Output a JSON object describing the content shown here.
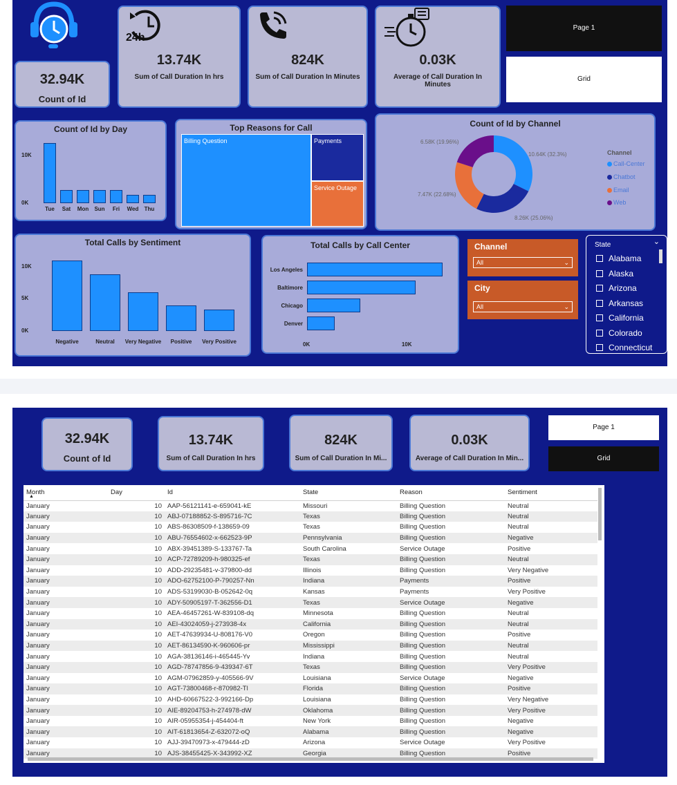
{
  "top": {
    "kpis": [
      {
        "value": "32.94K",
        "label": "Count of Id"
      },
      {
        "value": "13.74K",
        "label": "Sum of Call Duration In hrs"
      },
      {
        "value": "824K",
        "label": "Sum of Call Duration In Minutes"
      },
      {
        "value": "0.03K",
        "label": "Average of Call Duration In Minutes"
      }
    ],
    "nav": {
      "page1": "Page 1",
      "grid": "Grid"
    },
    "icons": {
      "kpi1": "headset-clock-icon",
      "kpi2": "24h-history-icon",
      "kpi3": "phone-ringing-icon",
      "kpi4": "stopwatch-speed-icon"
    },
    "icon_24h": "24h"
  },
  "chart_data": [
    {
      "type": "bar",
      "title": "Count of Id by Day",
      "categories": [
        "Tue",
        "Sat",
        "Mon",
        "Sun",
        "Fri",
        "Wed",
        "Thu"
      ],
      "values": [
        12500,
        2800,
        2800,
        2800,
        2700,
        1700,
        1700
      ],
      "yticks": [
        "10K",
        "0K"
      ],
      "ylim": [
        0,
        13000
      ]
    },
    {
      "type": "treemap",
      "title": "Top Reasons for Call",
      "categories": [
        "Billing Question",
        "Payments",
        "Service Outage"
      ],
      "colors": [
        "#1e90ff",
        "#1a2a9e",
        "#e8703a"
      ]
    },
    {
      "type": "pie",
      "title": "Count of Id by Channel",
      "legend_title": "Channel",
      "categories": [
        "Call-Center",
        "Chatbot",
        "Email",
        "Web"
      ],
      "values": [
        10.64,
        8.26,
        7.47,
        6.58
      ],
      "labels": [
        "10.64K (32.3%)",
        "8.26K (25.06%)",
        "7.47K (22.68%)",
        "6.58K (19.96%)"
      ],
      "colors": [
        "#1e90ff",
        "#1a2a9e",
        "#e8703a",
        "#6a0f8a"
      ]
    },
    {
      "type": "bar",
      "title": "Total Calls by Sentiment",
      "categories": [
        "Negative",
        "Neutral",
        "Very Negative",
        "Positive",
        "Very Positive"
      ],
      "values": [
        11000,
        8800,
        6000,
        4000,
        3300
      ],
      "yticks": [
        "10K",
        "5K",
        "0K"
      ],
      "ylim": [
        0,
        11500
      ]
    },
    {
      "type": "bar",
      "orientation": "horizontal",
      "title": "Total Calls by Call Center",
      "categories": [
        "Los Angeles",
        "Baltimore",
        "Chicago",
        "Denver"
      ],
      "values": [
        13700,
        11000,
        5400,
        2800
      ],
      "xticks": [
        "0K",
        "10K"
      ],
      "xlim": [
        0,
        14000
      ]
    }
  ],
  "slicers": {
    "channel": {
      "title": "Channel",
      "value": "All"
    },
    "city": {
      "title": "City",
      "value": "All"
    },
    "state": {
      "title": "State",
      "items": [
        "Alabama",
        "Alaska",
        "Arizona",
        "Arkansas",
        "California",
        "Colorado",
        "Connecticut"
      ]
    }
  },
  "grid_page": {
    "kpis": [
      {
        "value": "32.94K",
        "label": "Count of Id"
      },
      {
        "value": "13.74K",
        "label": "Sum of Call Duration In hrs"
      },
      {
        "value": "824K",
        "label": "Sum of Call Duration In Mi..."
      },
      {
        "value": "0.03K",
        "label": "Average of Call Duration In Min..."
      }
    ],
    "nav": {
      "page1": "Page 1",
      "grid": "Grid"
    },
    "table": {
      "columns": [
        "Month",
        "Day",
        "Id",
        "State",
        "Reason",
        "Sentiment"
      ],
      "rows": [
        [
          "January",
          "10",
          "AAP-56121141-e-659041-kE",
          "Missouri",
          "Billing Question",
          "Neutral"
        ],
        [
          "January",
          "10",
          "ABJ-07188852-S-895716-7C",
          "Texas",
          "Billing Question",
          "Neutral"
        ],
        [
          "January",
          "10",
          "ABS-86308509-f-138659-09",
          "Texas",
          "Billing Question",
          "Neutral"
        ],
        [
          "January",
          "10",
          "ABU-76554602-x-662523-9P",
          "Pennsylvania",
          "Billing Question",
          "Negative"
        ],
        [
          "January",
          "10",
          "ABX-39451389-S-133767-Ta",
          "South Carolina",
          "Service Outage",
          "Positive"
        ],
        [
          "January",
          "10",
          "ACP-72789209-h-980325-ef",
          "Texas",
          "Billing Question",
          "Neutral"
        ],
        [
          "January",
          "10",
          "ADD-29235481-v-379800-dd",
          "Illinois",
          "Billing Question",
          "Very Negative"
        ],
        [
          "January",
          "10",
          "ADO-62752100-P-790257-Nn",
          "Indiana",
          "Payments",
          "Positive"
        ],
        [
          "January",
          "10",
          "ADS-53199030-B-052642-0q",
          "Kansas",
          "Payments",
          "Very Positive"
        ],
        [
          "January",
          "10",
          "ADY-50905197-T-362556-D1",
          "Texas",
          "Service Outage",
          "Negative"
        ],
        [
          "January",
          "10",
          "AEA-46457261-W-839108-dq",
          "Minnesota",
          "Billing Question",
          "Neutral"
        ],
        [
          "January",
          "10",
          "AEI-43024059-j-273938-4x",
          "California",
          "Billing Question",
          "Neutral"
        ],
        [
          "January",
          "10",
          "AET-47639934-U-808176-V0",
          "Oregon",
          "Billing Question",
          "Positive"
        ],
        [
          "January",
          "10",
          "AET-86134590-K-960606-pr",
          "Mississippi",
          "Billing Question",
          "Neutral"
        ],
        [
          "January",
          "10",
          "AGA-38136146-i-465445-Yv",
          "Indiana",
          "Billing Question",
          "Neutral"
        ],
        [
          "January",
          "10",
          "AGD-78747856-9-439347-6T",
          "Texas",
          "Billing Question",
          "Very Positive"
        ],
        [
          "January",
          "10",
          "AGM-07962859-y-405566-9V",
          "Louisiana",
          "Service Outage",
          "Negative"
        ],
        [
          "January",
          "10",
          "AGT-73800468-r-870982-Tl",
          "Florida",
          "Billing Question",
          "Positive"
        ],
        [
          "January",
          "10",
          "AHD-60667522-3-992166-Dp",
          "Louisiana",
          "Billing Question",
          "Very Negative"
        ],
        [
          "January",
          "10",
          "AIE-89204753-h-274978-dW",
          "Oklahoma",
          "Billing Question",
          "Very Positive"
        ],
        [
          "January",
          "10",
          "AIR-05955354-j-454404-ft",
          "New York",
          "Billing Question",
          "Negative"
        ],
        [
          "January",
          "10",
          "AIT-61813654-Z-632072-oQ",
          "Alabama",
          "Billing Question",
          "Negative"
        ],
        [
          "January",
          "10",
          "AJJ-39470973-x-479444-zD",
          "Arizona",
          "Service Outage",
          "Very Positive"
        ],
        [
          "January",
          "10",
          "AJS-38455425-X-343992-XZ",
          "Georgia",
          "Billing Question",
          "Positive"
        ]
      ]
    }
  },
  "colors": {
    "background": "#0f1a8a",
    "card": "#b9b9d4",
    "accent": "#1e90ff",
    "slicer": "#c85a28"
  }
}
